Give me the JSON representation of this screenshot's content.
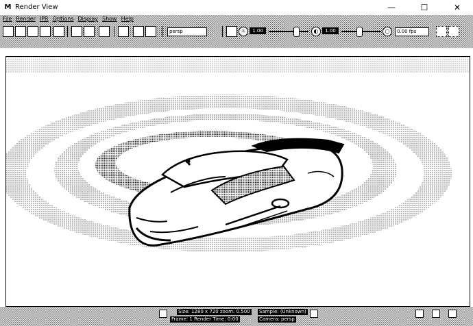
{
  "window": {
    "title": "Render View",
    "icon": "M",
    "minimize_glyph": "—",
    "maximize_glyph": "☐",
    "close_glyph": "✕"
  },
  "menu": {
    "items": [
      "File",
      "Render",
      "IPR",
      "Options",
      "Display",
      "Show",
      "Help"
    ]
  },
  "toolbar": {
    "camera_dropdown": "persp",
    "exposure_label": "1.00",
    "gamma_label": "1.00",
    "snapshot_label": "0.00 fps",
    "exposure_icon": "sun-icon",
    "gamma_icon": "contrast-icon"
  },
  "status": {
    "size_line": "Size: 1280 x 720   zoom: 0.500",
    "frame_line": "Frame: 1   Render Time: 0:00",
    "sample_line": "Sample: (Unknown)",
    "camera_line": "Camera: persp"
  },
  "colors": {
    "ink": "#000000",
    "paper": "#ffffff"
  }
}
